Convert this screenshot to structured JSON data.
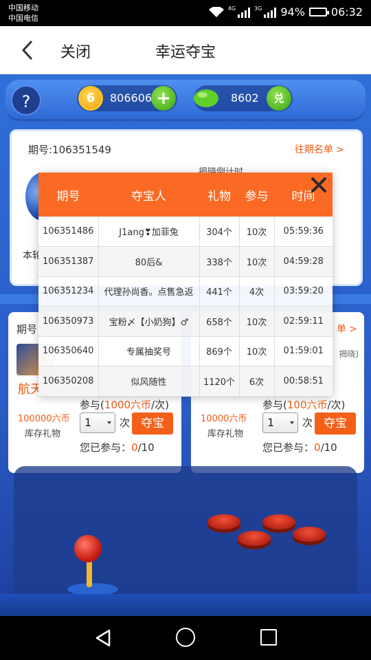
{
  "status_bar": {
    "carrier_1": "中国移动",
    "carrier_2": "中国电信",
    "net_1": "4G",
    "net_2": "3G",
    "battery": "94%",
    "battery_level": 0.94,
    "time": "06:32"
  },
  "header": {
    "close_label": "关闭",
    "title": "幸运夺宝"
  },
  "wallet": {
    "help": "?",
    "coin_badge": "6",
    "coins": "806606",
    "add": "+",
    "beans": "8602",
    "exchange": "兑"
  },
  "main_card": {
    "issue_label": "期号:106351549",
    "history_link": "往期名单 >",
    "round_label": "本轮",
    "countdown_label": "揭晓倒计时"
  },
  "left_card": {
    "issue_label": "期号",
    "prize_name": "航天",
    "participate_prefix": "参与(",
    "participate_cost": "1000六币",
    "participate_suffix": "/次)",
    "price": "100000六币",
    "stock": "库存礼物",
    "qty": "1",
    "qty_unit": "次",
    "grab": "夺宝",
    "joined_prefix": "您已参与：",
    "joined_count": "0",
    "joined_total": "/10"
  },
  "right_card": {
    "more": "单 >",
    "note": "揭晓)",
    "participate_prefix": "参与(",
    "participate_cost": "100六币",
    "participate_suffix": "/次)",
    "price": "10000六币",
    "stock": "库存礼物",
    "qty": "1",
    "qty_unit": "次",
    "grab": "夺宝",
    "joined_prefix": "您已参与：",
    "joined_count": "0",
    "joined_total": "/10"
  },
  "modal": {
    "columns": [
      "期号",
      "夺宝人",
      "礼物",
      "参与",
      "时间"
    ],
    "rows": [
      [
        "106351486",
        "J1ang❣加菲兔",
        "304个",
        "10次",
        "05:59:36"
      ],
      [
        "106351387",
        "80后&",
        "338个",
        "10次",
        "04:59:28"
      ],
      [
        "106351234",
        "代理孙尚香。点售急返",
        "441个",
        "4次",
        "03:59:20"
      ],
      [
        "106350973",
        "宝粉〆【小奶狗】♂",
        "658个",
        "10次",
        "02:59:11"
      ],
      [
        "106350640",
        "专属抽奖号",
        "869个",
        "10次",
        "01:59:01"
      ],
      [
        "106350208",
        "似风随性",
        "1120个",
        "6次",
        "00:58:51"
      ]
    ]
  },
  "colors": {
    "accent": "#fb6a24",
    "game_blue": "#2f6fd8"
  }
}
